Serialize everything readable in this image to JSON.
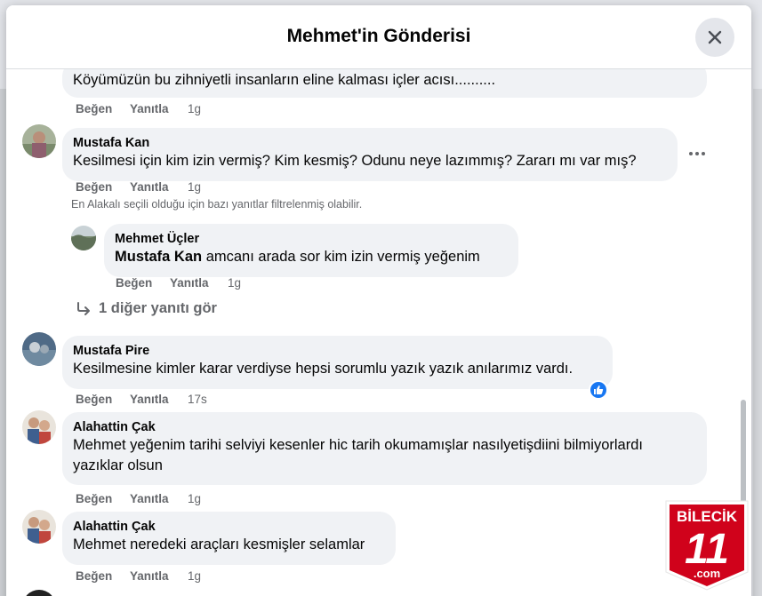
{
  "modal": {
    "title": "Mehmet'in Gönderisi",
    "close_icon": "close-icon"
  },
  "actions": {
    "like": "Beğen",
    "reply": "Yanıtla"
  },
  "comments": [
    {
      "author": "",
      "text": "Köyümüzün bu zihniyetli insanların eline kalması içler acısı..........",
      "time": "1g"
    },
    {
      "author": "Mustafa Kan",
      "text": "Kesilmesi için kim izin vermiş? Kim kesmiş? Odunu neye lazımmış? Zararı mı var mış?",
      "time": "1g"
    },
    {
      "author": "Mustafa Pire",
      "text": "Kesilmesine kimler karar verdiyse hepsi sorumlu yazık yazık anılarımız vardı.",
      "time": "17s",
      "reaction": "like-icon"
    },
    {
      "author": "Alahattin Çak",
      "text_line1": "Mehmet yeğenim tarihi selviyi kesenler hic tarih okumamışlar nasılyetişdiini bilmiyorlardı",
      "text_line2": "yazıklar olsun",
      "time": "1g"
    },
    {
      "author": "Alahattin Çak",
      "text": "Mehmet neredeki araçları kesmişler selamlar",
      "time": "1g"
    }
  ],
  "filter_note": "En Alakalı seçili olduğu için bazı yanıtlar filtrelenmiş olabilir.",
  "reply": {
    "author": "Mehmet Üçler",
    "mention": "Mustafa Kan",
    "text": " amcanı arada sor kim izin vermiş yeğenim",
    "time": "1g"
  },
  "more_replies": "1 diğer yanıtı gör",
  "watermark": {
    "brand": "BİLECİK",
    "number": "11",
    "domain": ".com",
    "color": "#d0021b"
  },
  "colors": {
    "accent": "#1877f2",
    "bubble": "#f0f2f5",
    "muted": "#65676b"
  }
}
